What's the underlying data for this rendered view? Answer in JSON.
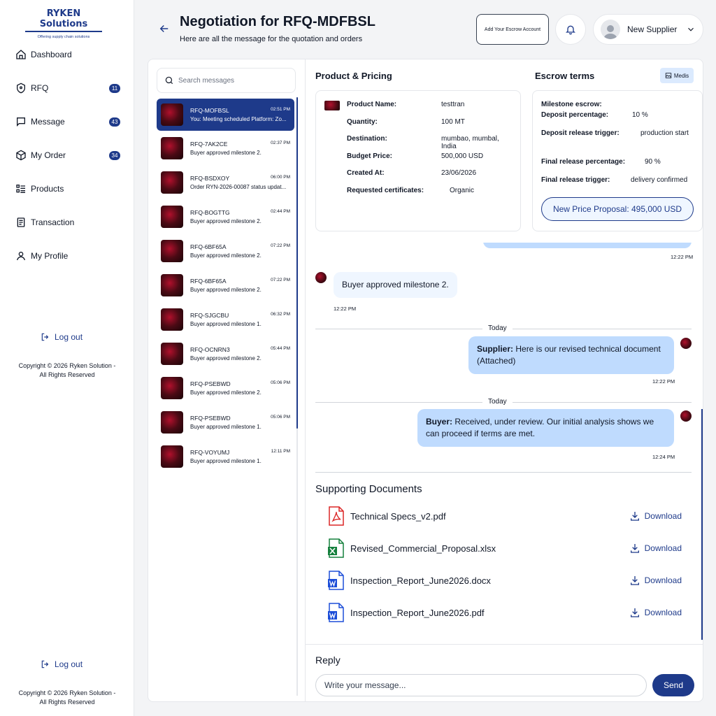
{
  "brand": {
    "name": "RYKEN Solutions",
    "tagline": "Offering supply chain solutions"
  },
  "nav": [
    {
      "label": "Dashboard",
      "icon": "home-icon",
      "badge": ""
    },
    {
      "label": "RFQ",
      "icon": "shield-icon",
      "badge": "11"
    },
    {
      "label": "Message",
      "icon": "chat-icon",
      "badge": "43"
    },
    {
      "label": "My Order",
      "icon": "box-icon",
      "badge": "34"
    },
    {
      "label": "Products",
      "icon": "list-icon",
      "badge": ""
    },
    {
      "label": "Transaction",
      "icon": "receipt-icon",
      "badge": ""
    },
    {
      "label": "My Profile",
      "icon": "user-icon",
      "badge": ""
    }
  ],
  "logout_label": "Log out",
  "copyright": "Copyright © 2026 Ryken Solution - All Rights Reserved",
  "header": {
    "title": "Negotiation for RFQ-MDFBSL",
    "subtitle": "Here are all the message for the quotation and orders",
    "escrow_button": "Add Your Escrow Account",
    "user_name": "New Supplier"
  },
  "search": {
    "placeholder": "Search messages"
  },
  "conversations": [
    {
      "code": "RFQ-MOFBSL",
      "time": "02:51 PM",
      "preview": "You: Meeting scheduled Platform: Zo...",
      "active": true
    },
    {
      "code": "RFQ-7AK2CE",
      "time": "02:37 PM",
      "preview": "Buyer approved milestone 2."
    },
    {
      "code": "RFQ-BSDXOY",
      "time": "06:00 PM",
      "preview": "Order RYN-2026-00087 status updat..."
    },
    {
      "code": "RFQ-BOGTTG",
      "time": "02:44 PM",
      "preview": "Buyer approved milestone 2."
    },
    {
      "code": "RFQ-6BF65A",
      "time": "07:22 PM",
      "preview": "Buyer approved milestone 2."
    },
    {
      "code": "RFQ-6BF65A",
      "time": "07:22 PM",
      "preview": "Buyer approved milestone 2."
    },
    {
      "code": "RFQ-SJGCBU",
      "time": "06:32 PM",
      "preview": "Buyer approved milestone 1."
    },
    {
      "code": "RFQ-OCNRN3",
      "time": "05:44 PM",
      "preview": "Buyer approved milestone 2."
    },
    {
      "code": "RFQ-PSEBWD",
      "time": "05:06 PM",
      "preview": "Buyer approved milestone 2."
    },
    {
      "code": "RFQ-PSEBWD",
      "time": "05:06 PM",
      "preview": "Buyer approved milestone 1."
    },
    {
      "code": "RFQ-VOYUMJ",
      "time": "12:11 PM",
      "preview": "Buyer approved milestone 1."
    }
  ],
  "product": {
    "heading": "Product & Pricing",
    "rows": [
      {
        "k": "Product Name:",
        "v": "testtran"
      },
      {
        "k": "Quantity:",
        "v": "100 MT"
      },
      {
        "k": "Destination:",
        "v": "mumbao, mumbal, India"
      },
      {
        "k": "Budget Price:",
        "v": "500,000 USD"
      },
      {
        "k": "Created At:",
        "v": "23/06/2026"
      },
      {
        "k": "Requested certificates:",
        "v": "Organic"
      }
    ]
  },
  "escrow": {
    "heading": "Escrow terms",
    "media_label": "Medis",
    "milestone_label": "Milestone escrow:",
    "rows": [
      {
        "k": "Deposit percentage:",
        "v": "10 %"
      },
      {
        "k": "Deposit release trigger:",
        "v": "production start"
      },
      {
        "k": "Final release percentage:",
        "v": "90 %"
      },
      {
        "k": "Final release trigger:",
        "v": "delivery confirmed"
      }
    ],
    "proposal": "New Price Proposal: 495,000 USD"
  },
  "messages": {
    "t0": "12:22 PM",
    "m1": {
      "text": "Buyer approved milestone 2.",
      "time": "12:22 PM"
    },
    "today1": "Today",
    "m2": {
      "sender": "Supplier:",
      "text": " Here is our revised technical document (Attached)",
      "time": "12:22 PM"
    },
    "today2": "Today",
    "m3": {
      "sender": "Buyer:",
      "text": " Received, under review. Our initial analysis shows we can proceed if terms are met.",
      "time": "12:24 PM"
    }
  },
  "documents": {
    "heading": "Supporting Documents",
    "download_label": "Download",
    "files": [
      {
        "name": "Technical Specs_v2.pdf",
        "type": "pdf"
      },
      {
        "name": "Revised_Commercial_Proposal.xlsx",
        "type": "xlsx"
      },
      {
        "name": "Inspection_Report_June2026.docx",
        "type": "docx"
      },
      {
        "name": "Inspection_Report_June2026.pdf",
        "type": "docx"
      }
    ]
  },
  "reply": {
    "heading": "Reply",
    "placeholder": "Write your message...",
    "send": "Send"
  },
  "colors": {
    "primary": "#1e3a8a",
    "bubble_out": "#bfdbfe",
    "bubble_in": "#eff6ff"
  }
}
